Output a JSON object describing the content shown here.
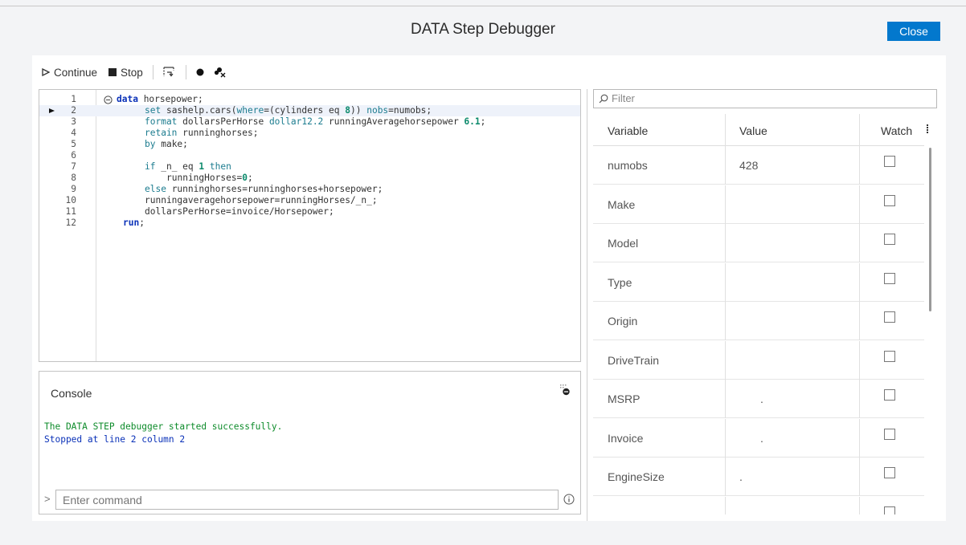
{
  "title": "DATA Step Debugger",
  "close_label": "Close",
  "toolbar": {
    "continue_label": "Continue",
    "stop_label": "Stop"
  },
  "editor": {
    "current_line": 2,
    "lines": [
      {
        "n": "1",
        "code": "data horsepower;"
      },
      {
        "n": "2",
        "code": "set sashelp.cars(where=(cylinders eq 8)) nobs=numobs;"
      },
      {
        "n": "3",
        "code": "format dollarsPerHorse dollar12.2 runningAveragehorsepower 6.1;"
      },
      {
        "n": "4",
        "code": "retain runninghorses;"
      },
      {
        "n": "5",
        "code": "by make;"
      },
      {
        "n": "6",
        "code": ""
      },
      {
        "n": "7",
        "code": "if _n_ eq 1 then"
      },
      {
        "n": "8",
        "code": "runningHorses=0;"
      },
      {
        "n": "9",
        "code": "else runninghorses=runninghorses+horsepower;"
      },
      {
        "n": "10",
        "code": "runningaveragehorsepower=runningHorses/_n_;"
      },
      {
        "n": "11",
        "code": "dollarsPerHorse=invoice/Horsepower;"
      },
      {
        "n": "12",
        "code": "run;"
      }
    ]
  },
  "console": {
    "title": "Console",
    "messages": [
      {
        "text": "The DATA STEP debugger started successfully.",
        "color": "#0d8b2a"
      },
      {
        "text": "Stopped at line 2 column 2",
        "color": "#0a31b8"
      }
    ],
    "prompt": ">",
    "placeholder": "Enter command"
  },
  "filter_placeholder": "Filter",
  "variables": {
    "columns": [
      "Variable",
      "Value",
      "Watch"
    ],
    "rows": [
      {
        "name": "numobs",
        "value": "428"
      },
      {
        "name": "Make",
        "value": ""
      },
      {
        "name": "Model",
        "value": ""
      },
      {
        "name": "Type",
        "value": ""
      },
      {
        "name": "Origin",
        "value": ""
      },
      {
        "name": "DriveTrain",
        "value": ""
      },
      {
        "name": "MSRP",
        "value": "."
      },
      {
        "name": "Invoice",
        "value": "."
      },
      {
        "name": "EngineSize",
        "value": "."
      },
      {
        "name": "",
        "value": ""
      }
    ]
  },
  "colors": {
    "accent": "#0378cd"
  }
}
